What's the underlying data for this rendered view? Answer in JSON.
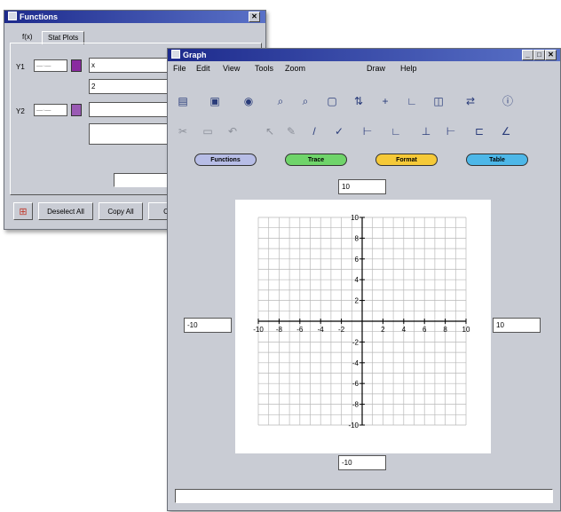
{
  "functions_window": {
    "title": "Functions",
    "tabs": [
      "f(x)",
      "Stat Plots"
    ],
    "rows": [
      {
        "label": "Y1",
        "color": "#8a2aa0",
        "expressions": [
          "x",
          "2"
        ]
      },
      {
        "label": "Y2",
        "color": "#9a5ab4",
        "expressions": [
          "",
          ""
        ]
      }
    ],
    "buttons": [
      "Deselect All",
      "Copy All",
      "C"
    ]
  },
  "graph_window": {
    "title": "Graph",
    "menu": [
      "File",
      "Edit",
      "View",
      "Tools",
      "Zoom",
      "Draw",
      "Help"
    ],
    "toolbar_row1": [
      "save-icon",
      "copy-icon",
      "paint-icon",
      "zoom-in-icon",
      "zoom-out-icon",
      "zoom-box-icon",
      "zoom-fit-icon",
      "crosshair-icon",
      "axes-icon",
      "square-axes-icon",
      "trace-icon",
      "info-icon"
    ],
    "toolbar_row2": [
      "cut-icon",
      "paste-icon",
      "undo-icon",
      "arrow-icon",
      "pencil-icon",
      "check-icon",
      "axes-style-1-icon",
      "axes-style-2-icon",
      "axes-style-3-icon",
      "axes-style-4-icon",
      "axes-style-5-icon",
      "axes-style-6-icon"
    ],
    "mode_buttons": [
      {
        "label": "Functions",
        "color": "#b7bde6"
      },
      {
        "label": "Trace",
        "color": "#6fd46a"
      },
      {
        "label": "Format",
        "color": "#f5c938"
      },
      {
        "label": "Table",
        "color": "#4db7e8"
      }
    ],
    "range": {
      "ymax": "10",
      "ymin": "-10",
      "xmin": "-10",
      "xmax": "10"
    }
  },
  "chart_data": {
    "type": "line",
    "xlim": [
      -10,
      10
    ],
    "ylim": [
      -10,
      10
    ],
    "grid": true,
    "x_ticks": [
      "-10",
      "-8",
      "-6",
      "-4",
      "-2",
      "2",
      "4",
      "6",
      "8",
      "10"
    ],
    "y_ticks": [
      "10",
      "8",
      "6",
      "4",
      "2",
      "-2",
      "-4",
      "-6",
      "-8",
      "-10"
    ],
    "series": []
  }
}
